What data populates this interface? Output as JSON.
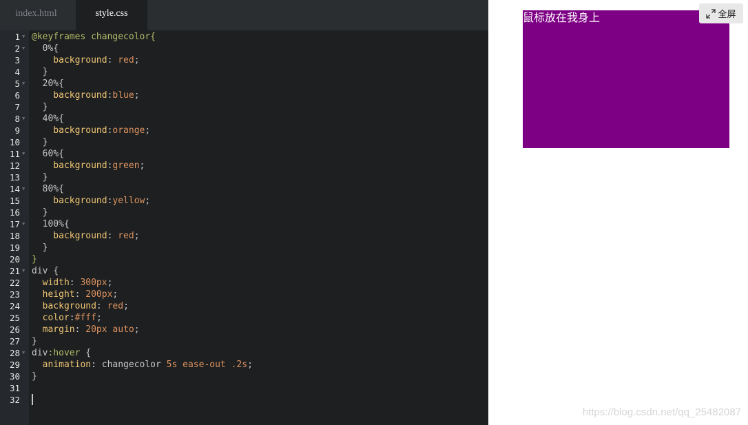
{
  "tabs": [
    {
      "label": "index.html",
      "active": false
    },
    {
      "label": "style.css",
      "active": true
    }
  ],
  "code_lines": [
    [
      {
        "t": "@keyframes changecolor{",
        "c": "at"
      }
    ],
    [
      {
        "t": "  0%{",
        "c": "plain"
      }
    ],
    [
      {
        "t": "    background",
        "c": "prop"
      },
      {
        "t": ": ",
        "c": "plain"
      },
      {
        "t": "red",
        "c": "val"
      },
      {
        "t": ";",
        "c": "plain"
      }
    ],
    [
      {
        "t": "  }",
        "c": "plain"
      }
    ],
    [
      {
        "t": "  20%{",
        "c": "plain"
      }
    ],
    [
      {
        "t": "    background",
        "c": "prop"
      },
      {
        "t": ":",
        "c": "plain"
      },
      {
        "t": "blue",
        "c": "val"
      },
      {
        "t": ";",
        "c": "plain"
      }
    ],
    [
      {
        "t": "  }",
        "c": "plain"
      }
    ],
    [
      {
        "t": "  40%{",
        "c": "plain"
      }
    ],
    [
      {
        "t": "    background",
        "c": "prop"
      },
      {
        "t": ":",
        "c": "plain"
      },
      {
        "t": "orange",
        "c": "val"
      },
      {
        "t": ";",
        "c": "plain"
      }
    ],
    [
      {
        "t": "  }",
        "c": "plain"
      }
    ],
    [
      {
        "t": "  60%{",
        "c": "plain"
      }
    ],
    [
      {
        "t": "    background",
        "c": "prop"
      },
      {
        "t": ":",
        "c": "plain"
      },
      {
        "t": "green",
        "c": "val"
      },
      {
        "t": ";",
        "c": "plain"
      }
    ],
    [
      {
        "t": "  }",
        "c": "plain"
      }
    ],
    [
      {
        "t": "  80%{",
        "c": "plain"
      }
    ],
    [
      {
        "t": "    background",
        "c": "prop"
      },
      {
        "t": ":",
        "c": "plain"
      },
      {
        "t": "yellow",
        "c": "val"
      },
      {
        "t": ";",
        "c": "plain"
      }
    ],
    [
      {
        "t": "  }",
        "c": "plain"
      }
    ],
    [
      {
        "t": "  100%{",
        "c": "plain"
      }
    ],
    [
      {
        "t": "    background",
        "c": "prop"
      },
      {
        "t": ": ",
        "c": "plain"
      },
      {
        "t": "red",
        "c": "val"
      },
      {
        "t": ";",
        "c": "plain"
      }
    ],
    [
      {
        "t": "  }",
        "c": "plain"
      }
    ],
    [
      {
        "t": "}",
        "c": "at"
      }
    ],
    [
      {
        "t": "div {",
        "c": "plain"
      }
    ],
    [
      {
        "t": "  width",
        "c": "prop"
      },
      {
        "t": ": ",
        "c": "plain"
      },
      {
        "t": "300px",
        "c": "val"
      },
      {
        "t": ";",
        "c": "plain"
      }
    ],
    [
      {
        "t": "  height",
        "c": "prop"
      },
      {
        "t": ": ",
        "c": "plain"
      },
      {
        "t": "200px",
        "c": "val"
      },
      {
        "t": ";",
        "c": "plain"
      }
    ],
    [
      {
        "t": "  background",
        "c": "prop"
      },
      {
        "t": ": ",
        "c": "plain"
      },
      {
        "t": "red",
        "c": "val"
      },
      {
        "t": ";",
        "c": "plain"
      }
    ],
    [
      {
        "t": "  color",
        "c": "prop"
      },
      {
        "t": ":",
        "c": "plain"
      },
      {
        "t": "#fff",
        "c": "val"
      },
      {
        "t": ";",
        "c": "plain"
      }
    ],
    [
      {
        "t": "  margin",
        "c": "prop"
      },
      {
        "t": ": ",
        "c": "plain"
      },
      {
        "t": "20px auto",
        "c": "val"
      },
      {
        "t": ";",
        "c": "plain"
      }
    ],
    [
      {
        "t": "}",
        "c": "plain"
      }
    ],
    [
      {
        "t": "div",
        "c": "plain"
      },
      {
        "t": ":hover",
        "c": "pseudo"
      },
      {
        "t": " {",
        "c": "plain"
      }
    ],
    [
      {
        "t": "  animation",
        "c": "prop"
      },
      {
        "t": ": changecolor ",
        "c": "plain"
      },
      {
        "t": "5s ease-out .2s",
        "c": "val"
      },
      {
        "t": ";",
        "c": "plain"
      }
    ],
    [
      {
        "t": "}",
        "c": "plain"
      }
    ],
    [],
    []
  ],
  "fold_lines": [
    1,
    2,
    5,
    8,
    11,
    14,
    17,
    21,
    28
  ],
  "preview": {
    "div_text": "鼠标放在我身上",
    "div_color": "#7d0084",
    "fullscreen_label": "全屏",
    "fullscreen_icon": "expand-icon"
  },
  "watermark": "https://blog.csdn.net/qq_25482087"
}
